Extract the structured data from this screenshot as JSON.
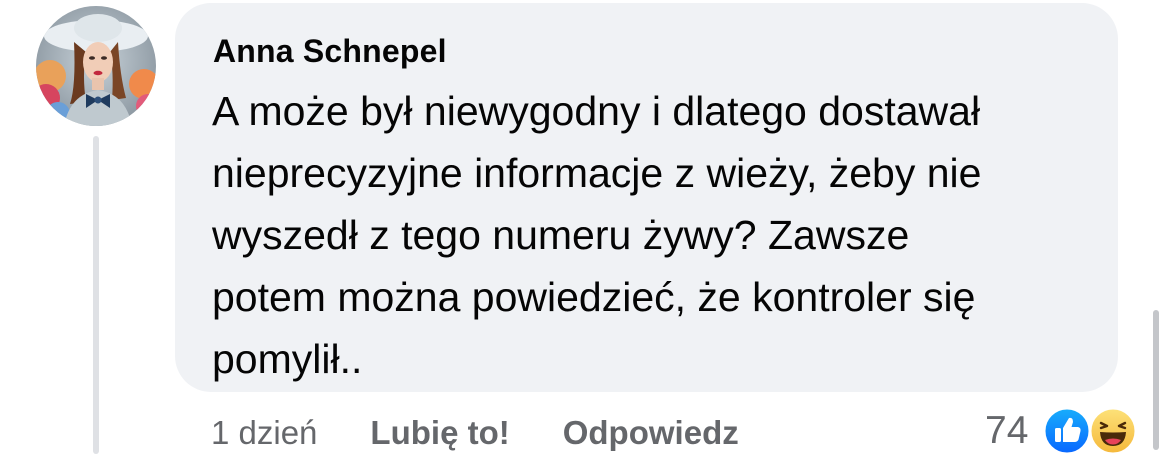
{
  "comment": {
    "author": "Anna Schnepel",
    "text": "A może był niewygodny i dlatego dostawał\nnieprecyzyjne informacje z wieży, żeby nie\nwyszedł z tego numeru żywy? Zawsze\npotem można powiedzieć, że kontroler się\npomylił..",
    "time": "1 dzień",
    "like_label": "Lubię to!",
    "reply_label": "Odpowiedz",
    "reaction_count": "74",
    "reaction_icons": [
      "like-icon",
      "haha-icon"
    ]
  },
  "colors": {
    "bubble": "#f0f2f5",
    "text": "#050505",
    "secondary_text": "#65676b",
    "like_blue": "#1877f2",
    "haha_yellow": "#f7c844"
  }
}
